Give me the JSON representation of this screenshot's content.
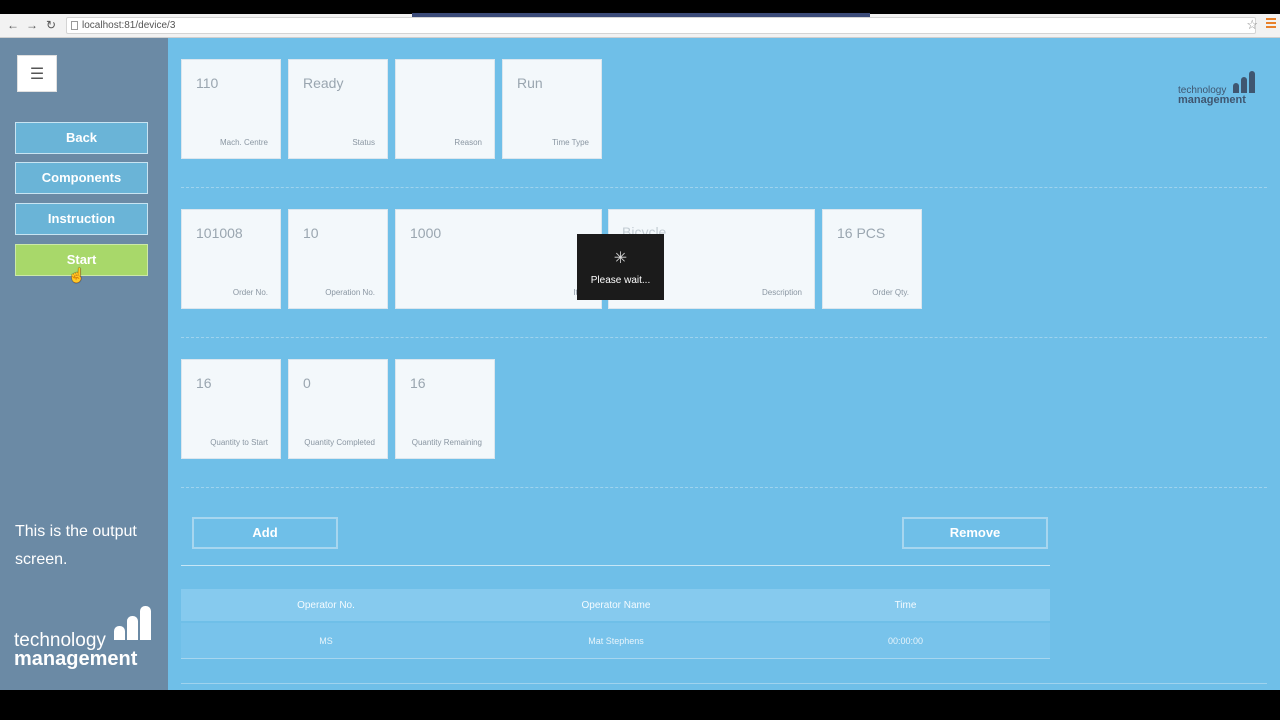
{
  "browser": {
    "url": "localhost:81/device/3"
  },
  "sidebar": {
    "menu_icon": "hamburger-icon",
    "buttons": [
      {
        "label": "Back"
      },
      {
        "label": "Components"
      },
      {
        "label": "Instruction"
      },
      {
        "label": "Start"
      }
    ],
    "note": "This is the output screen.",
    "logo": {
      "line1": "technology",
      "line2": "management"
    }
  },
  "brand": {
    "line1": "technology",
    "line2": "management"
  },
  "rows": [
    [
      {
        "value": "110",
        "caption": "Mach. Centre"
      },
      {
        "value": "Ready",
        "caption": "Status"
      },
      {
        "value": "",
        "caption": "Reason"
      },
      {
        "value": "Run",
        "caption": "Time Type"
      }
    ],
    [
      {
        "value": "101008",
        "caption": "Order No."
      },
      {
        "value": "10",
        "caption": "Operation No."
      },
      {
        "value": "1000",
        "caption": "Item"
      },
      {
        "value": "Bicycle",
        "caption": "Description"
      },
      {
        "value": "16 PCS",
        "caption": "Order Qty."
      }
    ],
    [
      {
        "value": "16",
        "caption": "Quantity to Start"
      },
      {
        "value": "0",
        "caption": "Quantity Completed"
      },
      {
        "value": "16",
        "caption": "Quantity Remaining"
      }
    ]
  ],
  "loading": {
    "text": "Please wait..."
  },
  "actions": {
    "add": "Add",
    "remove": "Remove"
  },
  "table": {
    "headers": [
      "Operator No.",
      "Operator Name",
      "Time"
    ],
    "rows": [
      [
        "MS",
        "Mat Stephens",
        "00:00:00"
      ]
    ]
  },
  "colors": {
    "background": "#6fbfe8",
    "sidebar": "#6b8aa5",
    "start_button": "#a8d86a",
    "tile": "#f3f8fb"
  }
}
